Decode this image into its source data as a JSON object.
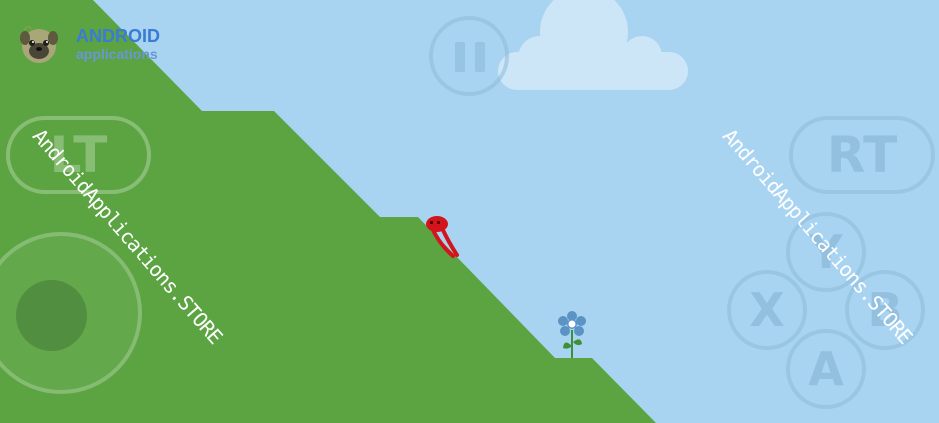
{
  "logo": {
    "title": "ANDROID",
    "subtitle": "applications",
    "icon": "pug-icon"
  },
  "watermark": "AndroidApplications.STORE",
  "controls": {
    "lt": "LT",
    "rt": "RT",
    "x": "X",
    "y": "Y",
    "b": "B",
    "a": "A",
    "pause_icon": "pause-icon"
  },
  "colors": {
    "sky": "#a8d4f2",
    "grass": "#5ba441",
    "player": "#d4141c",
    "flower": "#5a93c4",
    "cloud": "#cde6f7"
  }
}
